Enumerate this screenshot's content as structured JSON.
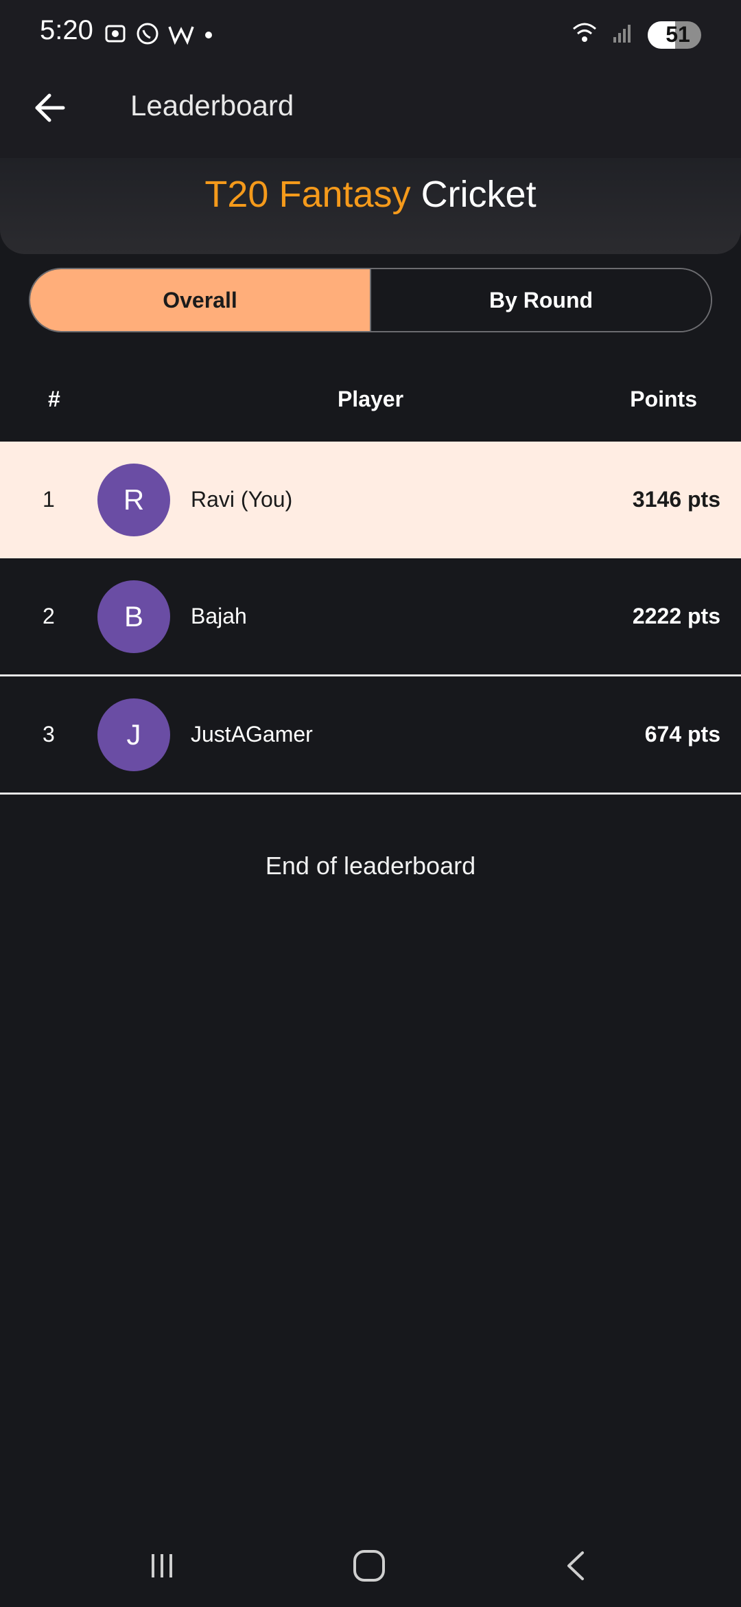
{
  "status_bar": {
    "time": "5:20",
    "battery": "51",
    "icons_left": [
      "screenshot-icon",
      "whatsapp-icon",
      "w-icon",
      "dot-icon"
    ],
    "icons_right": [
      "wifi-icon",
      "signal-icon",
      "battery-icon"
    ]
  },
  "app_bar": {
    "title": "Leaderboard",
    "back_icon": "arrow-left-icon"
  },
  "header": {
    "brand_accent": "T20 Fantasy",
    "brand_white": "Cricket",
    "accent_color": "#f59a1b"
  },
  "tabs": {
    "overall": "Overall",
    "by_round": "By Round",
    "active": "Overall"
  },
  "table": {
    "columns": {
      "rank": "#",
      "player": "Player",
      "points": "Points"
    },
    "rows": [
      {
        "rank": "1",
        "initial": "R",
        "name": "Ravi (You)",
        "points": "3146 pts",
        "highlight": true
      },
      {
        "rank": "2",
        "initial": "B",
        "name": "Bajah",
        "points": "2222 pts",
        "highlight": false
      },
      {
        "rank": "3",
        "initial": "J",
        "name": "JustAGamer",
        "points": "674 pts",
        "highlight": false
      }
    ]
  },
  "footer_text": "End of leaderboard",
  "nav": {
    "recents": "recents-icon",
    "home": "home-icon",
    "back": "back-icon"
  }
}
